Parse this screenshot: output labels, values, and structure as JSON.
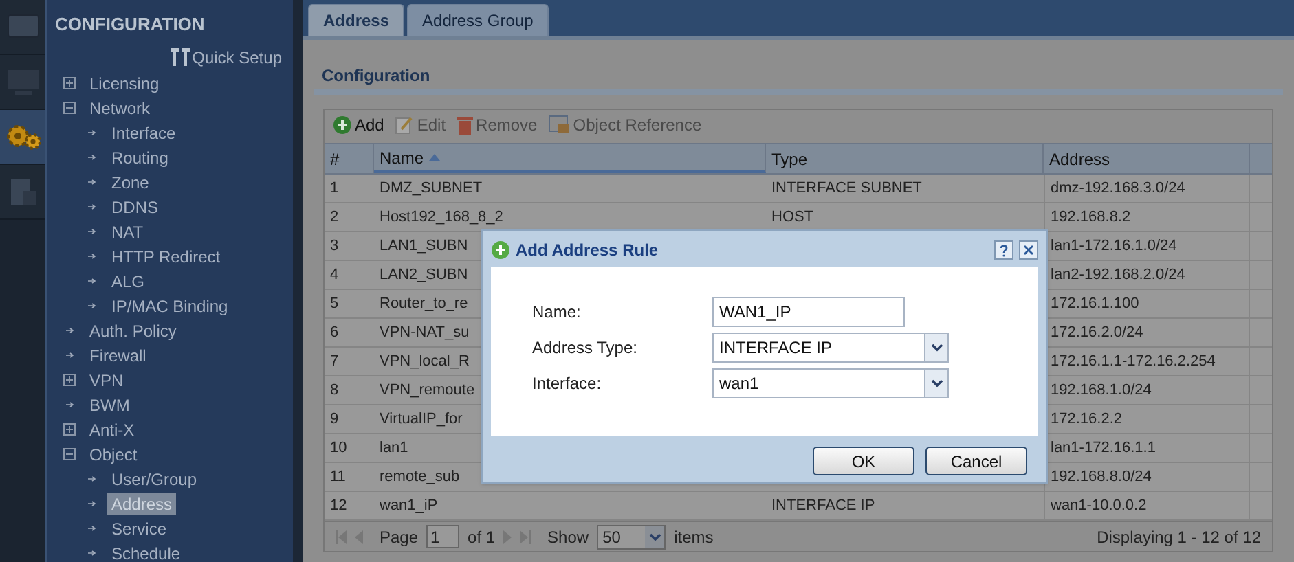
{
  "nav_icons": [
    {
      "selected": false
    },
    {
      "selected": false
    },
    {
      "selected": true
    },
    {
      "selected": false
    }
  ],
  "sidebar": {
    "title": "CONFIGURATION",
    "quick_setup": "Quick Setup",
    "items": [
      {
        "kind": "group",
        "label": "Licensing",
        "expanded": false,
        "selected": false
      },
      {
        "kind": "group",
        "label": "Network",
        "expanded": true,
        "selected": false,
        "children": [
          {
            "kind": "link",
            "label": "Interface",
            "selected": false
          },
          {
            "kind": "link",
            "label": "Routing",
            "selected": false
          },
          {
            "kind": "link",
            "label": "Zone",
            "selected": false
          },
          {
            "kind": "link",
            "label": "DDNS",
            "selected": false
          },
          {
            "kind": "link",
            "label": "NAT",
            "selected": false
          },
          {
            "kind": "link",
            "label": "HTTP Redirect",
            "selected": false
          },
          {
            "kind": "link",
            "label": "ALG",
            "selected": false
          },
          {
            "kind": "link",
            "label": "IP/MAC Binding",
            "selected": false
          }
        ]
      },
      {
        "kind": "link",
        "label": "Auth. Policy",
        "selected": false
      },
      {
        "kind": "link",
        "label": "Firewall",
        "selected": false
      },
      {
        "kind": "group",
        "label": "VPN",
        "expanded": false,
        "selected": false
      },
      {
        "kind": "link",
        "label": "BWM",
        "selected": false
      },
      {
        "kind": "group",
        "label": "Anti-X",
        "expanded": false,
        "selected": false
      },
      {
        "kind": "group",
        "label": "Object",
        "expanded": true,
        "selected": false,
        "children": [
          {
            "kind": "link",
            "label": "User/Group",
            "selected": false
          },
          {
            "kind": "link",
            "label": "Address",
            "selected": true
          },
          {
            "kind": "link",
            "label": "Service",
            "selected": false
          },
          {
            "kind": "link",
            "label": "Schedule",
            "selected": false
          }
        ]
      }
    ]
  },
  "tabs": [
    {
      "label": "Address",
      "selected": true
    },
    {
      "label": "Address Group",
      "selected": false
    }
  ],
  "section_title": "Configuration",
  "toolbar": [
    {
      "kind": "add",
      "label": "Add",
      "disabled": false
    },
    {
      "kind": "edit",
      "label": "Edit",
      "disabled": true
    },
    {
      "kind": "remove",
      "label": "Remove",
      "disabled": true
    },
    {
      "kind": "reference",
      "label": "Object Reference",
      "disabled": true
    }
  ],
  "table": {
    "columns": [
      {
        "label": "#",
        "sorted": false
      },
      {
        "label": "Name",
        "sorted": true
      },
      {
        "label": "Type",
        "sorted": false
      },
      {
        "label": "Address",
        "sorted": false
      }
    ],
    "rows": [
      {
        "number": "1",
        "name": "DMZ_SUBNET",
        "type": "INTERFACE SUBNET",
        "address": "dmz-192.168.3.0/24"
      },
      {
        "number": "2",
        "name": "Host192_168_8_2",
        "type": "HOST",
        "address": "192.168.8.2"
      },
      {
        "number": "3",
        "name": "LAN1_SUBN",
        "address": "lan1-172.16.1.0/24"
      },
      {
        "number": "4",
        "name": "LAN2_SUBN",
        "address": "lan2-192.168.2.0/24"
      },
      {
        "number": "5",
        "name": "Router_to_re",
        "address": "172.16.1.100"
      },
      {
        "number": "6",
        "name": "VPN-NAT_su",
        "address": "172.16.2.0/24"
      },
      {
        "number": "7",
        "name": "VPN_local_R",
        "address": "172.16.1.1-172.16.2.254"
      },
      {
        "number": "8",
        "name": "VPN_remoute",
        "address": "192.168.1.0/24"
      },
      {
        "number": "9",
        "name": "VirtualIP_for",
        "address": "172.16.2.2"
      },
      {
        "number": "10",
        "name": "lan1",
        "address": "lan1-172.16.1.1"
      },
      {
        "number": "11",
        "name": "remote_sub",
        "address": "192.168.8.0/24"
      },
      {
        "number": "12",
        "name": "wan1_iP",
        "type": "INTERFACE IP",
        "address": "wan1-10.0.0.2"
      }
    ]
  },
  "pager": {
    "page_label": "Page",
    "page": "1",
    "of": "of 1",
    "show_label": "Show",
    "show": "50",
    "items_label": "items",
    "displaying": "Displaying 1 - 12 of 12"
  },
  "dialog": {
    "title": "Add Address Rule",
    "fields": [
      {
        "kind": "text",
        "label": "Name:",
        "value": "WAN1_IP"
      },
      {
        "kind": "select",
        "label": "Address Type:",
        "value": "INTERFACE IP"
      },
      {
        "kind": "select",
        "label": "Interface:",
        "value": "wan1"
      }
    ],
    "buttons": [
      "OK",
      "Cancel"
    ]
  }
}
